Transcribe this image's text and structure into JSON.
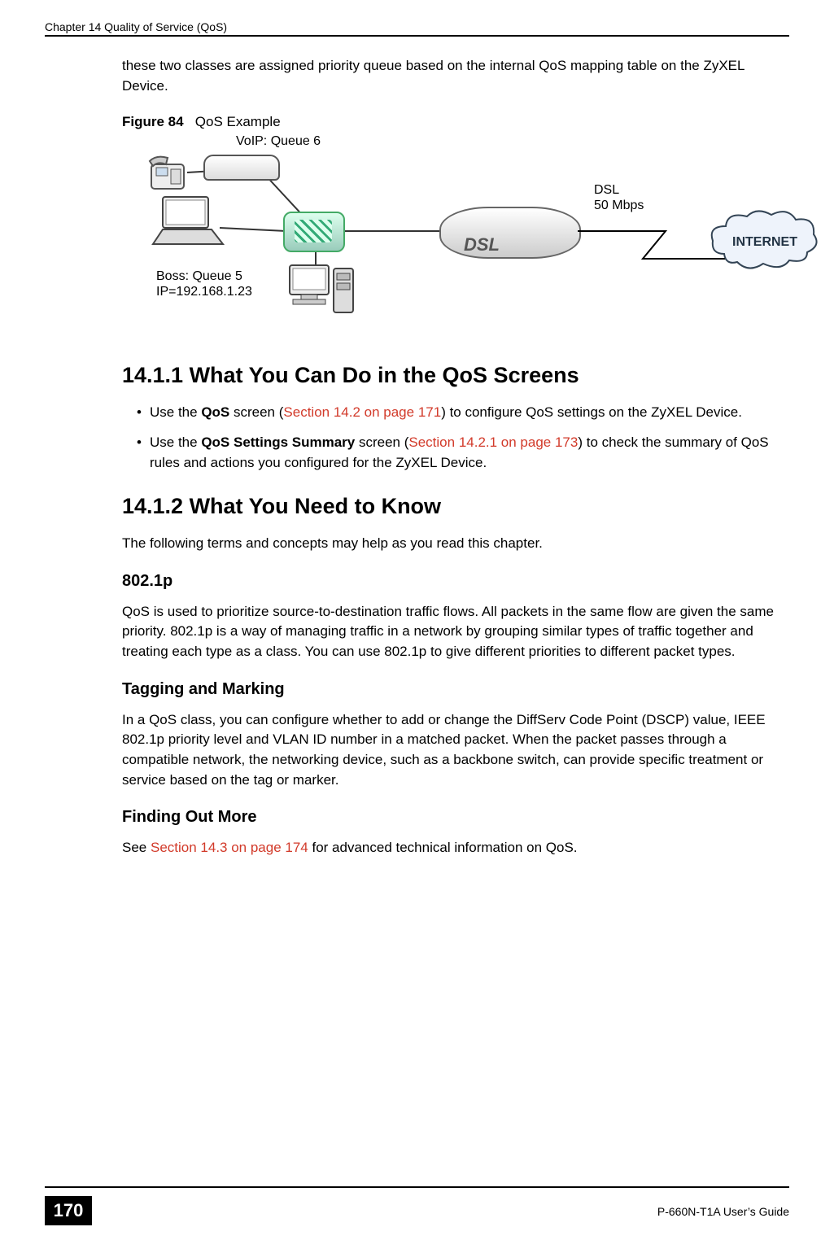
{
  "header": {
    "chapter_left": "Chapter 14 Quality of Service (QoS)"
  },
  "intro_paragraph": "these two classes are assigned priority queue based on the internal QoS mapping table on the ZyXEL Device.",
  "figure": {
    "label": "Figure 84",
    "title": "QoS Example",
    "voip_label": "VoIP: Queue 6",
    "boss_label_line1": "Boss: Queue 5",
    "boss_label_line2": "IP=192.168.1.23",
    "dsl_line1": "DSL",
    "dsl_line2": "50 Mbps",
    "dsl_device_text": "DSL",
    "cloud_text": "INTERNET"
  },
  "sections": {
    "s1411": {
      "heading": "14.1.1  What You Can Do in the QoS Screens",
      "bullet1_pre": "Use the ",
      "bullet1_bold": "QoS",
      "bullet1_mid": " screen (",
      "bullet1_link": "Section 14.2 on page 171",
      "bullet1_post": ") to configure QoS settings on the ZyXEL Device.",
      "bullet2_pre": "Use the ",
      "bullet2_bold": "QoS Settings Summary",
      "bullet2_mid": " screen (",
      "bullet2_link": "Section 14.2.1 on page 173",
      "bullet2_post": ") to check the summary of QoS rules and actions you configured for the ZyXEL Device."
    },
    "s1412": {
      "heading": "14.1.2  What You Need to Know",
      "intro": "The following terms and concepts may help as you read this chapter.",
      "h_8021p": "802.1p",
      "p_8021p": "QoS is used to prioritize source-to-destination traffic flows. All packets in the same flow are given the same priority. 802.1p is a way of managing traffic in a network by grouping similar types of traffic together and treating each type as a class. You can use 802.1p to give different priorities to different packet types.",
      "h_tag": "Tagging and Marking",
      "p_tag": "In a QoS class, you can configure whether to add or change the DiffServ Code Point (DSCP) value, IEEE 802.1p priority level and VLAN ID number in a matched packet. When the packet passes through a compatible network, the networking device, such as a backbone switch, can provide specific treatment or service based on the tag or marker.",
      "h_find": "Finding Out More",
      "find_pre": "See ",
      "find_link": "Section 14.3 on page 174",
      "find_post": " for advanced technical information on QoS."
    }
  },
  "footer": {
    "page_number": "170",
    "guide": "P-660N-T1A User’s Guide"
  }
}
